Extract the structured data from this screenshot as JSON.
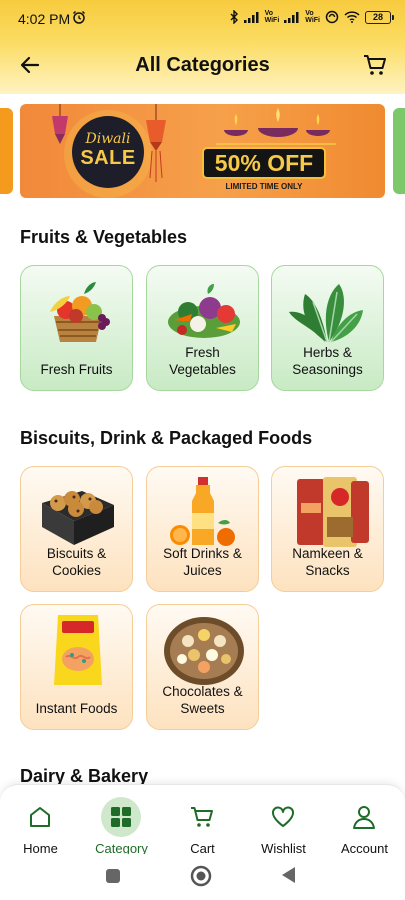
{
  "status": {
    "time": "4:02 PM",
    "net1": "Vo\nWiFi",
    "net2": "Vo\nWiFi",
    "battery": "28"
  },
  "header": {
    "title": "All Categories"
  },
  "banner": {
    "sale_small": "Diwali",
    "sale_big": "SALE",
    "offer": "50% OFF",
    "offer_sub": "LIMITED TIME ONLY"
  },
  "sections": [
    {
      "title": "Fruits & Vegetables",
      "tiles": [
        "Fresh Fruits",
        "Fresh\nVegetables",
        "Herbs &\nSeasonings"
      ]
    },
    {
      "title": "Biscuits, Drink & Packaged Foods",
      "tiles": [
        "Biscuits &\nCookies",
        "Soft Drinks &\nJuices",
        "Namkeen &\nSnacks",
        "Instant Foods",
        "Chocolates &\nSweets"
      ]
    },
    {
      "title": "Dairy & Bakery"
    }
  ],
  "bottom_nav": {
    "items": [
      "Home",
      "Category",
      "Cart",
      "Wishlist",
      "Account"
    ],
    "active": "Category"
  },
  "colors": {
    "accent_green": "#1f6b28",
    "header_yellow": "#f7cb3e",
    "banner_orange": "#f1893a"
  }
}
